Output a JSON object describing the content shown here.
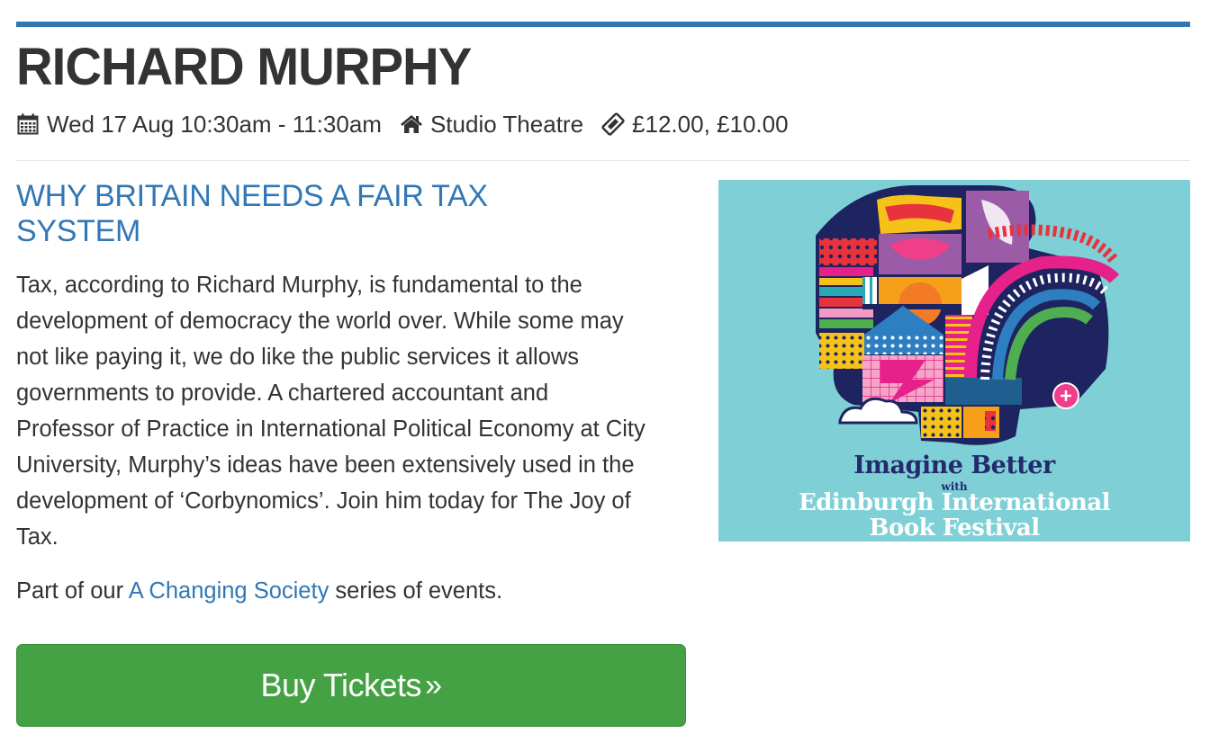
{
  "event": {
    "author": "RICHARD MURPHY",
    "date_time": "Wed 17 Aug 10:30am - 11:30am",
    "venue": "Studio Theatre",
    "price": "£12.00, £10.00",
    "title": "WHY BRITAIN NEEDS A FAIR TAX SYSTEM",
    "description": "Tax, according to Richard Murphy, is fundamental to the development of democracy the world over. While some may not like paying it, we do like the public services it allows governments to provide. A chartered accountant and Professor of Practice in International Political Economy at City University, Murphy’s ideas have been extensively used in the development of ‘Corbynomics’. Join him today for The Joy of Tax.",
    "series_prefix": "Part of our ",
    "series_link": "A Changing Society",
    "series_suffix": " series of events.",
    "buy_label": "Buy Tickets",
    "buy_chevron": "»"
  },
  "poster": {
    "arc_text": "IMAGINE BETTER",
    "line1": "Imagine Better",
    "line2": "with",
    "line3": "Edinburgh International",
    "line4": "Book Festival"
  },
  "colors": {
    "accent_blue": "#3177b6",
    "buy_green": "#45a244",
    "poster_bg": "#7fd0d6",
    "poster_navy": "#242a6e"
  },
  "icons": {
    "date": "calendar-icon",
    "venue": "home-icon",
    "price": "ticket-icon"
  }
}
